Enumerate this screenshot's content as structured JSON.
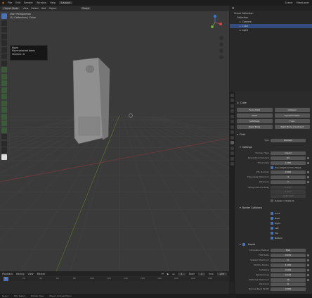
{
  "topbar": {
    "menus": [
      "File",
      "Edit",
      "Render",
      "Window",
      "Help"
    ],
    "workspace": "Layout",
    "scene": "Scene",
    "view_layer": "ViewLayer"
  },
  "viewport": {
    "header_items": [
      "Object Mode",
      "View",
      "Select",
      "Add",
      "Object"
    ],
    "transform_orientation": "Global",
    "view_name": "User Perspective",
    "collection_label": "(1) Collection | Cube",
    "tooltip": {
      "title": "Move",
      "line1": "Move selected items",
      "line2": "Shortcut: G"
    }
  },
  "outliner": {
    "title": "Scene Collection",
    "rows": [
      {
        "label": "Collection",
        "selected": false
      },
      {
        "label": "Camera",
        "selected": false
      },
      {
        "label": "Cube",
        "selected": true
      },
      {
        "label": "Light",
        "selected": false
      }
    ]
  },
  "properties": {
    "object_name": "Cube",
    "physics_buttons": [
      [
        "Force Field",
        "Collision"
      ],
      [
        "Cloth",
        "Dynamic Paint"
      ],
      [
        "Soft Body",
        "Fluid"
      ],
      [
        "Rigid Body",
        "Rigid Body Constraint"
      ]
    ],
    "fluid_header": "Fluid",
    "type_label": "Type",
    "type_value": "Domain",
    "settings_header": "Settings",
    "settings_rows": [
      {
        "label": "Domain Type",
        "value": "Liquid"
      },
      {
        "label": "Resolution Divisions",
        "value": "64"
      },
      {
        "label": "Time Scale",
        "value": "1.000"
      },
      {
        "label": "CFL Number",
        "value": "4.000"
      },
      {
        "label": "Timesteps Maximum",
        "value": "4"
      },
      {
        "label": "Minimum",
        "value": "1"
      }
    ],
    "adaptive_label": "Use Adaptive Time Steps",
    "gravity_label": "Using Scene Gravity",
    "gravity_values": [
      "0 m/s²",
      "0 m/s²",
      "-9.81 m/s²"
    ],
    "delete_label": "Delete in Obstacle",
    "border_header": "Border Collisions",
    "border_items": [
      {
        "label": "Front",
        "checked": true
      },
      {
        "label": "Back",
        "checked": true
      },
      {
        "label": "Right",
        "checked": true
      },
      {
        "label": "Left",
        "checked": true
      },
      {
        "label": "Top",
        "checked": true
      },
      {
        "label": "Bottom",
        "checked": true
      }
    ],
    "liquid_header": "Liquid",
    "liquid_rows": [
      {
        "label": "Simulation Method",
        "value": "FLIP"
      },
      {
        "label": "FLIP Ratio",
        "value": "0.970"
      },
      {
        "label": "System Maximum",
        "value": "0"
      },
      {
        "label": "Particle Radius",
        "value": "1.000"
      },
      {
        "label": "Sampling",
        "value": "0.000"
      },
      {
        "label": "Randomness",
        "value": "0.100"
      },
      {
        "label": "Particles Maximum",
        "value": "16"
      },
      {
        "label": "Minimum",
        "value": "8"
      },
      {
        "label": "Narrow Band Width",
        "value": "3.000"
      }
    ]
  },
  "timeline": {
    "menus": [
      "Playback",
      "Keying",
      "View",
      "Marker"
    ],
    "current_frame": "1",
    "start_label": "Start",
    "start": "1",
    "end_label": "End",
    "end": "250",
    "ticks": [
      "0",
      "20",
      "40",
      "60",
      "80",
      "100",
      "120",
      "140",
      "160",
      "180",
      "200",
      "220",
      "240"
    ]
  },
  "statusbar": {
    "items": [
      "Select",
      "Box Select",
      "Rotate View",
      "Object Context Menu"
    ]
  }
}
